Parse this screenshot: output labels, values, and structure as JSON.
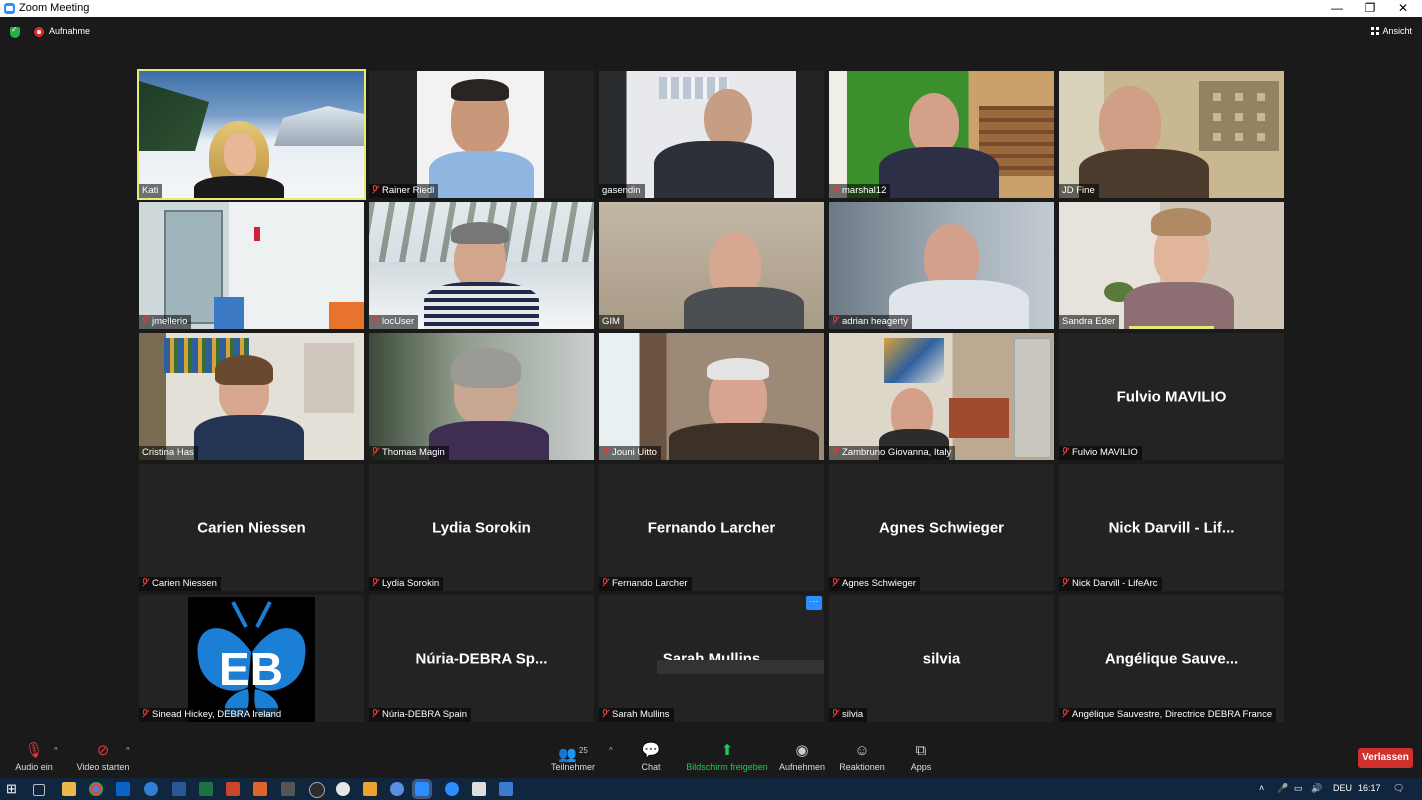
{
  "window": {
    "title": "Zoom Meeting",
    "minimize": "—",
    "restore": "❐",
    "close": "✕"
  },
  "meeting_bar": {
    "recording_label": "Aufnahme",
    "view_label": "Ansicht"
  },
  "participants": [
    {
      "name": "Kati",
      "label": "Kati",
      "video": true,
      "muted": false,
      "active": true
    },
    {
      "name": "Rainer Riedl",
      "label": "Rainer Riedl",
      "video": true,
      "muted": true
    },
    {
      "name": "gasendin",
      "label": "gasendin",
      "video": true,
      "muted": false
    },
    {
      "name": "marshal12",
      "label": "marshal12",
      "video": true,
      "muted": true
    },
    {
      "name": "JD Fine",
      "label": "JD Fine",
      "video": true,
      "muted": false
    },
    {
      "name": "jmellerio",
      "label": "jmellerio",
      "video": true,
      "muted": true
    },
    {
      "name": "locUser",
      "label": "locUser",
      "video": true,
      "muted": true
    },
    {
      "name": "GIM",
      "label": "GIM",
      "video": true,
      "muted": false
    },
    {
      "name": "adrian heagerty",
      "label": "adrian heagerty",
      "video": true,
      "muted": true
    },
    {
      "name": "Sandra Eder",
      "label": "Sandra Eder",
      "video": true,
      "muted": false
    },
    {
      "name": "Cristina Has",
      "label": "Cristina Has",
      "video": true,
      "muted": false
    },
    {
      "name": "Thomas Magin",
      "label": "Thomas Magin",
      "video": true,
      "muted": true
    },
    {
      "name": "Jouni Uitto",
      "label": "Jouni Uitto",
      "video": true,
      "muted": true
    },
    {
      "name": "Zambruno Giovanna, Italy",
      "label": "Zambruno Giovanna, Italy",
      "video": true,
      "muted": true
    },
    {
      "name": "Fulvio MAVILIO",
      "label": "Fulvio MAVILIO",
      "display_name": "Fulvio MAVILIO",
      "video": false,
      "muted": true
    },
    {
      "name": "Carien Niessen",
      "label": "Carien Niessen",
      "display_name": "Carien Niessen",
      "video": false,
      "muted": true
    },
    {
      "name": "Lydia Sorokin",
      "label": "Lydia Sorokin",
      "display_name": "Lydia Sorokin",
      "video": false,
      "muted": true
    },
    {
      "name": "Fernando Larcher",
      "label": "Fernando Larcher",
      "display_name": "Fernando Larcher",
      "video": false,
      "muted": true
    },
    {
      "name": "Agnes Schwieger",
      "label": "Agnes Schwieger",
      "display_name": "Agnes Schwieger",
      "video": false,
      "muted": true
    },
    {
      "name": "Nick Darvill - LifeArc",
      "label": "Nick Darvill - LifeArc",
      "display_name": "Nick Darvill - Lif...",
      "video": false,
      "muted": true
    },
    {
      "name": "Sinead Hickey, DEBRA Ireland",
      "label": "Sinead Hickey, DEBRA Ireland",
      "video": false,
      "logo": true,
      "muted": true
    },
    {
      "name": "Núria-DEBRA Spain",
      "label": "Núria-DEBRA Spain",
      "display_name": "Núria-DEBRA  Sp...",
      "video": false,
      "muted": true
    },
    {
      "name": "Sarah Mullins",
      "label": "Sarah Mullins",
      "display_name": "Sarah Mullins",
      "video": false,
      "muted": true,
      "more_button": "···"
    },
    {
      "name": "silvia",
      "label": "silvia",
      "display_name": "silvia",
      "video": false,
      "muted": true
    },
    {
      "name": "Angélique Sauvestre, Directrice DEBRA France",
      "label": "Angélique Sauvestre, Directrice DEBRA France",
      "display_name": "Angélique  Sauve...",
      "video": false,
      "muted": true
    }
  ],
  "toolbar": {
    "audio": "Audio ein",
    "video": "Video starten",
    "participants": "Teilnehmer",
    "participants_count": "25",
    "chat": "Chat",
    "share": "Bildschirm freigeben",
    "record": "Aufnehmen",
    "reactions": "Reaktionen",
    "apps": "Apps",
    "leave": "Verlassen"
  },
  "taskbar": {
    "language": "DEU",
    "time": "16:17"
  },
  "colors": {
    "active_speaker": "#e7ea71",
    "share_green": "#22c55e",
    "leave_red": "#d0312d",
    "accent_blue": "#2d8cff"
  }
}
